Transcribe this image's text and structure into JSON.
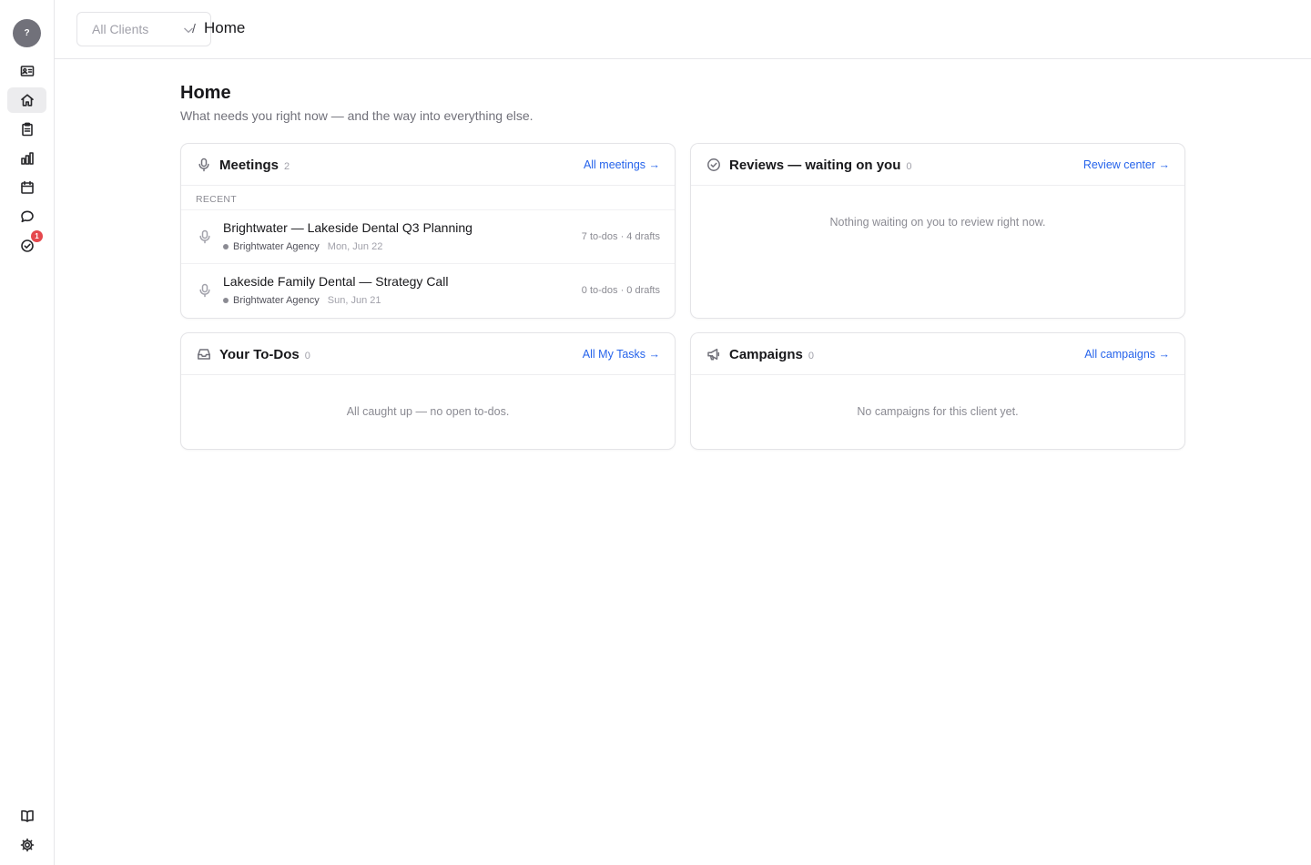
{
  "sidebar": {
    "avatar_initial": "?",
    "notification_count": "1",
    "items": [
      {
        "icon": "id-card-icon"
      },
      {
        "icon": "home-icon",
        "active": true
      },
      {
        "icon": "clipboard-icon"
      },
      {
        "icon": "bar-chart-icon"
      },
      {
        "icon": "calendar-icon"
      },
      {
        "icon": "chat-icon"
      },
      {
        "icon": "check-circle-icon"
      }
    ],
    "bottom_items": [
      {
        "icon": "book-icon"
      },
      {
        "icon": "gear-icon"
      }
    ]
  },
  "topbar": {
    "client_select": "All Clients",
    "separator": "/",
    "breadcrumb": "Home"
  },
  "page": {
    "title": "Home",
    "subtitle": "What needs you right now — and the way into everything else."
  },
  "meetings": {
    "title": "Meetings",
    "count": "2",
    "link": "All meetings →",
    "section_label": "RECENT",
    "rows": [
      {
        "title": "Brightwater — Lakeside Dental Q3 Planning",
        "client": "Brightwater Agency",
        "date": "Mon, Jun 22",
        "stats": "7 to-dos · 4 drafts"
      },
      {
        "title": "Lakeside Family Dental — Strategy Call",
        "client": "Brightwater Agency",
        "date": "Sun, Jun 21",
        "stats": "0 to-dos · 0 drafts"
      }
    ]
  },
  "reviews": {
    "title": "Reviews — waiting on you",
    "count": "0",
    "link": "Review center →",
    "empty": "Nothing waiting on you to review right now."
  },
  "todos": {
    "title": "Your To-Dos",
    "count": "0",
    "link": "All My Tasks →",
    "empty": "All caught up — no open to-dos."
  },
  "campaigns": {
    "title": "Campaigns",
    "count": "0",
    "link": "All campaigns →",
    "empty": "No campaigns for this client yet."
  },
  "colors": {
    "accent_link": "#2563eb",
    "badge": "#e5484d",
    "avatar": "#71717a"
  }
}
